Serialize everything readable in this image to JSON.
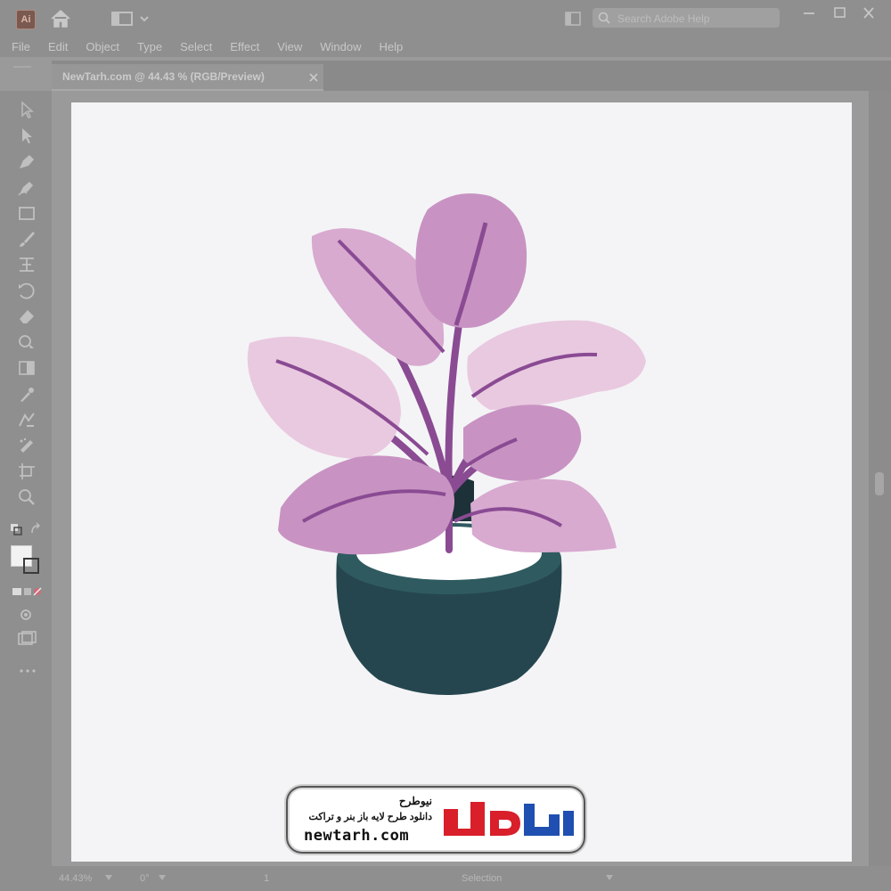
{
  "app": {
    "logo_label": "Ai"
  },
  "search": {
    "placeholder": "Search Adobe Help"
  },
  "menu": [
    "File",
    "Edit",
    "Object",
    "Type",
    "Select",
    "Effect",
    "View",
    "Window",
    "Help"
  ],
  "document_tab": {
    "label": "NewTarh.com @ 44.43 % (RGB/Preview)"
  },
  "tools": [
    "selection-tool-icon",
    "direct-selection-tool-icon",
    "pen-tool-icon",
    "curvature-tool-icon",
    "rectangle-tool-icon",
    "paintbrush-tool-icon",
    "width-tool-icon",
    "rotate-tool-icon",
    "eraser-tool-icon",
    "shape-builder-tool-icon",
    "gradient-tool-icon",
    "eyedropper-tool-icon",
    "blend-tool-icon",
    "symbol-sprayer-tool-icon",
    "artboard-tool-icon",
    "zoom-tool-icon"
  ],
  "colors": {
    "leaf_light": "#e9c9e0",
    "leaf_mid": "#d8aad0",
    "leaf_dark": "#c893c2",
    "stem": "#8a4b93",
    "pot": "#26464f",
    "pot_rim": "#2f5b60",
    "soil": "#1c3238"
  },
  "watermark": {
    "logo_text": "نیوطرح",
    "brand_fa": "نیوطرح",
    "tagline": "دانلود طرح لایه باز بنر و تراکت",
    "url": "newtarh.com"
  },
  "status": {
    "zoom": "44.43%",
    "angle": "0°",
    "artboard": "1",
    "tool": "Selection"
  }
}
